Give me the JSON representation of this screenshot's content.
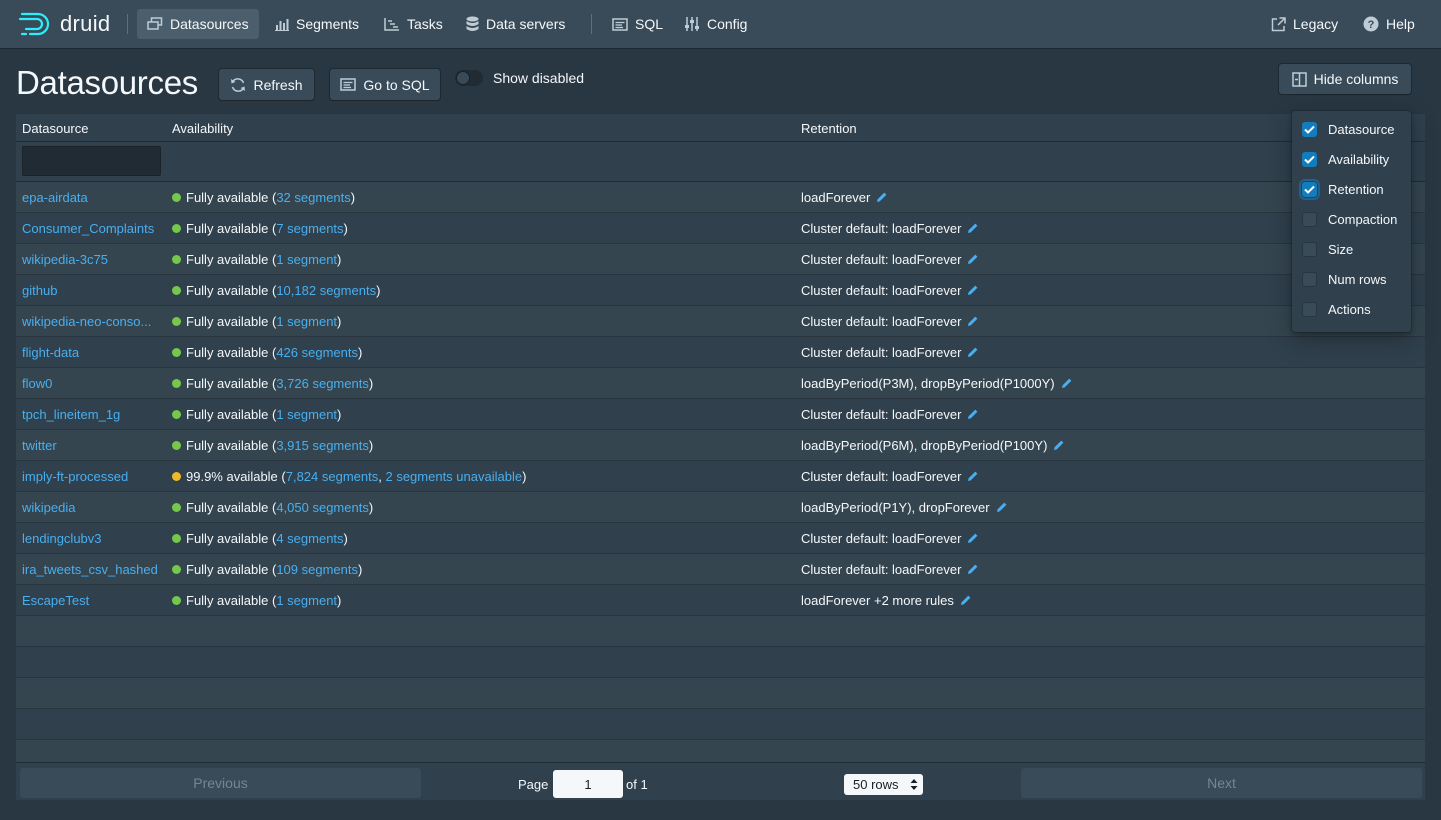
{
  "app": {
    "logo_text": "druid"
  },
  "nav": {
    "items": [
      {
        "label": "Datasources",
        "icon": "datasources-icon",
        "active": true
      },
      {
        "label": "Segments",
        "icon": "segments-icon"
      },
      {
        "label": "Tasks",
        "icon": "tasks-icon"
      },
      {
        "label": "Data servers",
        "icon": "database-icon"
      },
      {
        "label": "SQL",
        "icon": "sql-icon"
      },
      {
        "label": "Config",
        "icon": "config-icon"
      }
    ],
    "legacy_label": "Legacy",
    "help_label": "Help"
  },
  "page": {
    "title": "Datasources",
    "refresh_label": "Refresh",
    "go_to_sql_label": "Go to SQL",
    "show_disabled_label": "Show disabled",
    "hide_columns_label": "Hide columns"
  },
  "table": {
    "headers": {
      "datasource": "Datasource",
      "availability": "Availability",
      "retention": "Retention"
    },
    "rows": [
      {
        "datasource": "epa-airdata",
        "status": "Fully available (",
        "segments": "32 segments",
        "unavailable": "",
        "suffix": ")",
        "status_color": "#75c84b",
        "retention": "loadForever"
      },
      {
        "datasource": "Consumer_Complaints",
        "status": "Fully available (",
        "segments": "7 segments",
        "unavailable": "",
        "suffix": ")",
        "status_color": "#75c84b",
        "retention": "Cluster default: loadForever"
      },
      {
        "datasource": "wikipedia-3c75",
        "status": "Fully available (",
        "segments": "1 segment",
        "unavailable": "",
        "suffix": ")",
        "status_color": "#75c84b",
        "retention": "Cluster default: loadForever"
      },
      {
        "datasource": "github",
        "status": "Fully available (",
        "segments": "10,182 segments",
        "unavailable": "",
        "suffix": ")",
        "status_color": "#75c84b",
        "retention": "Cluster default: loadForever"
      },
      {
        "datasource": "wikipedia-neo-conso...",
        "status": "Fully available (",
        "segments": "1 segment",
        "unavailable": "",
        "suffix": ")",
        "status_color": "#75c84b",
        "retention": "Cluster default: loadForever"
      },
      {
        "datasource": "flight-data",
        "status": "Fully available (",
        "segments": "426 segments",
        "unavailable": "",
        "suffix": ")",
        "status_color": "#75c84b",
        "retention": "Cluster default: loadForever"
      },
      {
        "datasource": "flow0",
        "status": "Fully available (",
        "segments": "3,726 segments",
        "unavailable": "",
        "suffix": ")",
        "status_color": "#75c84b",
        "retention": "loadByPeriod(P3M), dropByPeriod(P1000Y)"
      },
      {
        "datasource": "tpch_lineitem_1g",
        "status": "Fully available (",
        "segments": "1 segment",
        "unavailable": "",
        "suffix": ")",
        "status_color": "#75c84b",
        "retention": "Cluster default: loadForever"
      },
      {
        "datasource": "twitter",
        "status": "Fully available (",
        "segments": "3,915 segments",
        "unavailable": "",
        "suffix": ")",
        "status_color": "#75c84b",
        "retention": "loadByPeriod(P6M), dropByPeriod(P100Y)"
      },
      {
        "datasource": "imply-ft-processed",
        "status": "99.9% available (",
        "segments": "7,824 segments",
        "unavailable": "2 segments unavailable",
        "suffix": ")",
        "status_color": "#f2b824",
        "retention": "Cluster default: loadForever"
      },
      {
        "datasource": "wikipedia",
        "status": "Fully available (",
        "segments": "4,050 segments",
        "unavailable": "",
        "suffix": ")",
        "status_color": "#75c84b",
        "retention": "loadByPeriod(P1Y), dropForever"
      },
      {
        "datasource": "lendingclubv3",
        "status": "Fully available (",
        "segments": "4 segments",
        "unavailable": "",
        "suffix": ")",
        "status_color": "#75c84b",
        "retention": "Cluster default: loadForever"
      },
      {
        "datasource": "ira_tweets_csv_hashed",
        "status": "Fully available (",
        "segments": "109 segments",
        "unavailable": "",
        "suffix": ")",
        "status_color": "#75c84b",
        "retention": "Cluster default: loadForever"
      },
      {
        "datasource": "EscapeTest",
        "status": "Fully available (",
        "segments": "1 segment",
        "unavailable": "",
        "suffix": ")",
        "status_color": "#75c84b",
        "retention": "loadForever +2 more rules"
      }
    ]
  },
  "pagination": {
    "previous_label": "Previous",
    "next_label": "Next",
    "page_label": "Page",
    "page_value": "1",
    "of_label": "of 1",
    "rows_label": "50 rows"
  },
  "columns_menu": [
    {
      "label": "Datasource",
      "checked": true
    },
    {
      "label": "Availability",
      "checked": true
    },
    {
      "label": "Retention",
      "checked": true,
      "focused": true
    },
    {
      "label": "Compaction",
      "checked": false
    },
    {
      "label": "Size",
      "checked": false
    },
    {
      "label": "Num rows",
      "checked": false
    },
    {
      "label": "Actions",
      "checked": false
    }
  ],
  "colors": {
    "link": "#48aff0",
    "navbar": "#394b59",
    "background": "#293742",
    "checkbox": "#137cbd"
  }
}
